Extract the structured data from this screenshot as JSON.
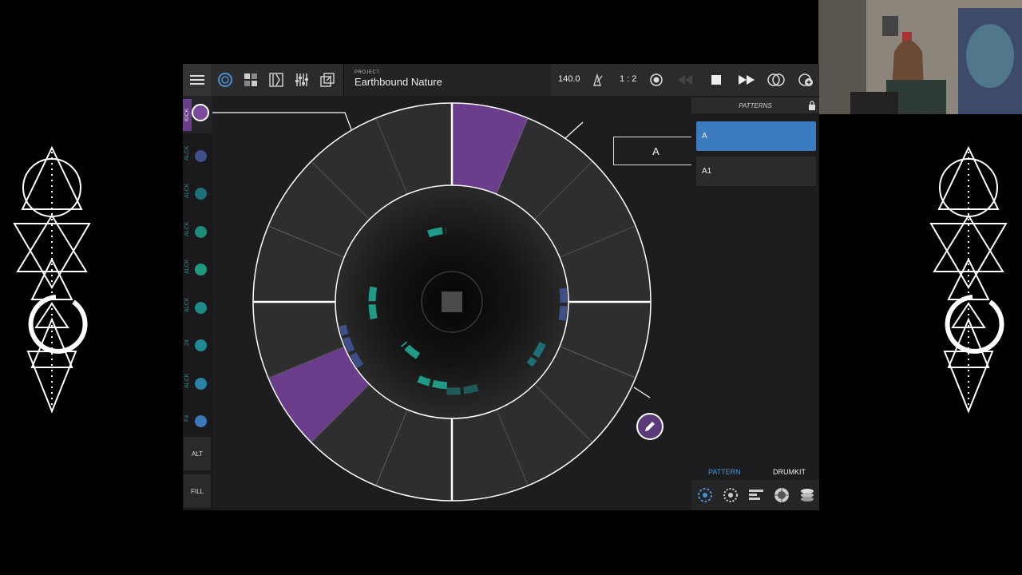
{
  "toolbar": {
    "menu_icon": "hamburger-icon",
    "view_icons": [
      "circle-view-icon",
      "grid-view-icon",
      "mixer-icon",
      "sliders-icon",
      "export-icon"
    ],
    "project_label": "PROJECT",
    "project_name": "Earthbound Nature",
    "tempo": "140.0",
    "time_signature": "1 : 2",
    "transport_icons": [
      "metronome-icon",
      "record-icon",
      "rewind-icon",
      "stop-icon",
      "fast-forward-icon",
      "loop-icon",
      "add-loop-icon"
    ]
  },
  "lanes": [
    {
      "label": "KICK",
      "color": "#7b4a9a",
      "active": true
    },
    {
      "label": "ALCK",
      "color": "#3e4f8a",
      "active": false
    },
    {
      "label": "ALCK",
      "color": "#1f6f78",
      "active": false
    },
    {
      "label": "ALCK",
      "color": "#1f8a7a",
      "active": false
    },
    {
      "label": "ALCK",
      "color": "#1f9a80",
      "active": false
    },
    {
      "label": "ALCK",
      "color": "#1f8a86",
      "active": false
    },
    {
      "label": "24",
      "color": "#1f8a94",
      "active": false
    },
    {
      "label": "ALCK",
      "color": "#2a84a8",
      "active": false
    },
    {
      "label": "FX",
      "color": "#3a7ab8",
      "active": false
    }
  ],
  "side_buttons": {
    "alt": "ALT",
    "fill": "FILL"
  },
  "sequencer": {
    "pattern_letter": "A",
    "steps": 16,
    "active_steps": [
      0,
      10
    ],
    "accent_color": "#6a3e8a",
    "edit_icon": "pencil-icon",
    "stop_icon": "square-stop-icon"
  },
  "patterns": {
    "header": "PATTERNS",
    "lock_icon": "lock-icon",
    "items": [
      {
        "label": "A",
        "selected": true
      },
      {
        "label": "A1",
        "selected": false
      }
    ],
    "tabs": {
      "pattern": "PATTERN",
      "drumkit": "DRUMKIT"
    },
    "bottom_icons": [
      "pattern-circle-icon",
      "dotted-circle-icon",
      "bars-icon",
      "knob-icon",
      "stack-icon"
    ]
  },
  "colors": {
    "accent_blue": "#3b7bbf",
    "purple": "#6a3e8a",
    "teal": "#1f9a88"
  }
}
